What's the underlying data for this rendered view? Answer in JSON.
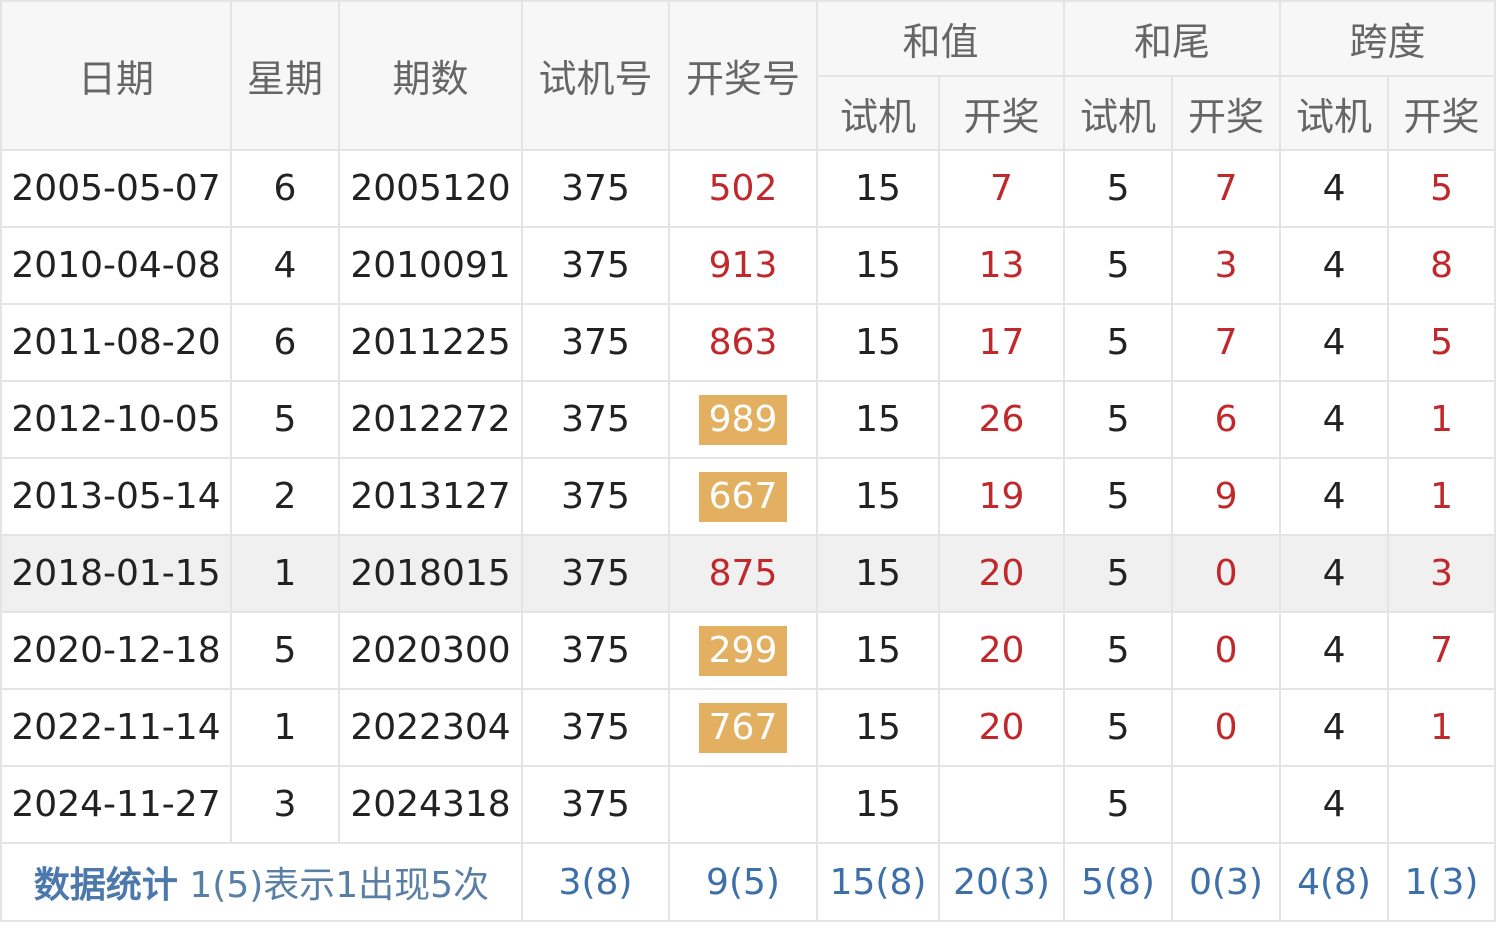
{
  "headers": {
    "date": "日期",
    "weekday": "星期",
    "issue": "期数",
    "test_number": "试机号",
    "draw_number": "开奖号",
    "sum_group": "和值",
    "tail_group": "和尾",
    "span_group": "跨度",
    "sub_test": "试机",
    "sub_draw": "开奖"
  },
  "rows": [
    {
      "date": "2005-05-07",
      "weekday": "6",
      "issue": "2005120",
      "test": "375",
      "draw": "502",
      "hot": false,
      "sum_test": "15",
      "sum_draw": "7",
      "tail_test": "5",
      "tail_draw": "7",
      "span_test": "4",
      "span_draw": "5"
    },
    {
      "date": "2010-04-08",
      "weekday": "4",
      "issue": "2010091",
      "test": "375",
      "draw": "913",
      "hot": false,
      "sum_test": "15",
      "sum_draw": "13",
      "tail_test": "5",
      "tail_draw": "3",
      "span_test": "4",
      "span_draw": "8"
    },
    {
      "date": "2011-08-20",
      "weekday": "6",
      "issue": "2011225",
      "test": "375",
      "draw": "863",
      "hot": false,
      "sum_test": "15",
      "sum_draw": "17",
      "tail_test": "5",
      "tail_draw": "7",
      "span_test": "4",
      "span_draw": "5"
    },
    {
      "date": "2012-10-05",
      "weekday": "5",
      "issue": "2012272",
      "test": "375",
      "draw": "989",
      "hot": true,
      "sum_test": "15",
      "sum_draw": "26",
      "tail_test": "5",
      "tail_draw": "6",
      "span_test": "4",
      "span_draw": "1"
    },
    {
      "date": "2013-05-14",
      "weekday": "2",
      "issue": "2013127",
      "test": "375",
      "draw": "667",
      "hot": true,
      "sum_test": "15",
      "sum_draw": "19",
      "tail_test": "5",
      "tail_draw": "9",
      "span_test": "4",
      "span_draw": "1"
    },
    {
      "date": "2018-01-15",
      "weekday": "1",
      "issue": "2018015",
      "test": "375",
      "draw": "875",
      "hot": false,
      "sum_test": "15",
      "sum_draw": "20",
      "tail_test": "5",
      "tail_draw": "0",
      "span_test": "4",
      "span_draw": "3"
    },
    {
      "date": "2020-12-18",
      "weekday": "5",
      "issue": "2020300",
      "test": "375",
      "draw": "299",
      "hot": true,
      "sum_test": "15",
      "sum_draw": "20",
      "tail_test": "5",
      "tail_draw": "0",
      "span_test": "4",
      "span_draw": "7"
    },
    {
      "date": "2022-11-14",
      "weekday": "1",
      "issue": "2022304",
      "test": "375",
      "draw": "767",
      "hot": true,
      "sum_test": "15",
      "sum_draw": "20",
      "tail_test": "5",
      "tail_draw": "0",
      "span_test": "4",
      "span_draw": "1"
    },
    {
      "date": "2024-11-27",
      "weekday": "3",
      "issue": "2024318",
      "test": "375",
      "draw": "",
      "hot": false,
      "sum_test": "15",
      "sum_draw": "",
      "tail_test": "5",
      "tail_draw": "",
      "span_test": "4",
      "span_draw": ""
    }
  ],
  "highlight_row_index": 5,
  "stats": {
    "label": "数据统计",
    "note": "1(5)表示1出现5次",
    "test": "3(8)",
    "draw": "9(5)",
    "sum_test": "15(8)",
    "sum_draw": "20(3)",
    "tail_test": "5(8)",
    "tail_draw": "0(3)",
    "span_test": "4(8)",
    "span_draw": "1(3)"
  },
  "colors": {
    "draw_red": "#c0282c",
    "hot_badge_bg": "#e3b062",
    "stats_blue": "#3d6fa8",
    "header_bg": "#f7f7f7",
    "highlight_row_bg": "#f0f0f0"
  }
}
